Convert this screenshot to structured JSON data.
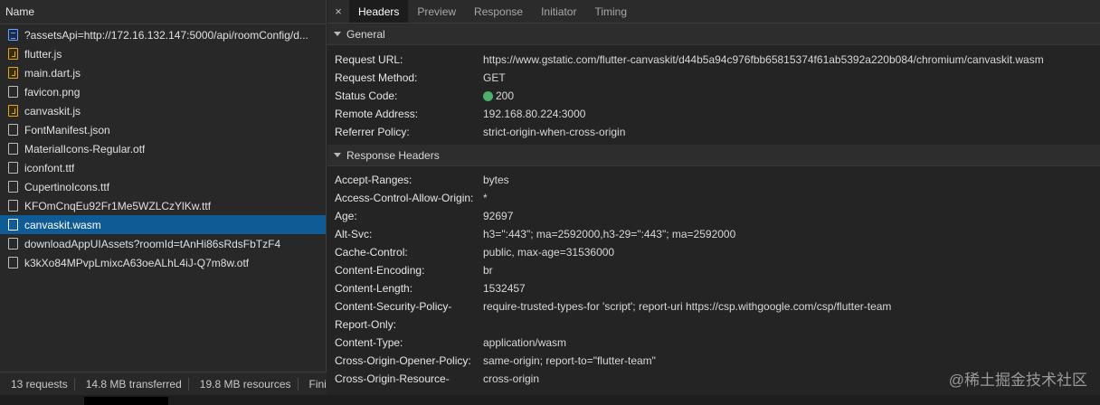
{
  "left_panel": {
    "header": "Name",
    "files": [
      {
        "name": "?assetsApi=http://172.16.132.147:5000/api/roomConfig/d...",
        "icon": "document-icon",
        "type": "doc"
      },
      {
        "name": "flutter.js",
        "icon": "script-file-icon",
        "type": "js"
      },
      {
        "name": "main.dart.js",
        "icon": "script-file-icon",
        "type": "js"
      },
      {
        "name": "favicon.png",
        "icon": "file-icon",
        "type": "plain"
      },
      {
        "name": "canvaskit.js",
        "icon": "script-file-icon",
        "type": "js"
      },
      {
        "name": "FontManifest.json",
        "icon": "file-icon",
        "type": "plain"
      },
      {
        "name": "MaterialIcons-Regular.otf",
        "icon": "file-icon",
        "type": "plain"
      },
      {
        "name": "iconfont.ttf",
        "icon": "file-icon",
        "type": "plain"
      },
      {
        "name": "CupertinoIcons.ttf",
        "icon": "file-icon",
        "type": "plain"
      },
      {
        "name": "KFOmCnqEu92Fr1Me5WZLCzYlKw.ttf",
        "icon": "file-icon",
        "type": "plain"
      },
      {
        "name": "canvaskit.wasm",
        "icon": "file-icon",
        "type": "plain",
        "selected": true
      },
      {
        "name": "downloadAppUIAssets?roomId=tAnHi86sRdsFbTzF4",
        "icon": "file-icon",
        "type": "plain"
      },
      {
        "name": "k3kXo84MPvpLmixcA63oeALhL4iJ-Q7m8w.otf",
        "icon": "file-icon",
        "type": "plain"
      }
    ],
    "status": {
      "requests": "13 requests",
      "transferred": "14.8 MB transferred",
      "resources": "19.8 MB resources",
      "finish": "Fini"
    }
  },
  "tabs": {
    "close": "×",
    "items": [
      "Headers",
      "Preview",
      "Response",
      "Initiator",
      "Timing"
    ],
    "active": "Headers"
  },
  "general": {
    "title": "General",
    "rows": [
      {
        "key": "Request URL:",
        "value": "https://www.gstatic.com/flutter-canvaskit/d44b5a94c976fbb65815374f61ab5392a220b084/chromium/canvaskit.wasm"
      },
      {
        "key": "Request Method:",
        "value": "GET"
      },
      {
        "key": "Status Code:",
        "value": "200",
        "status_color": "#4caf6a"
      },
      {
        "key": "Remote Address:",
        "value": "192.168.80.224:3000"
      },
      {
        "key": "Referrer Policy:",
        "value": "strict-origin-when-cross-origin"
      }
    ]
  },
  "response_headers": {
    "title": "Response Headers",
    "rows": [
      {
        "key": "Accept-Ranges:",
        "value": "bytes"
      },
      {
        "key": "Access-Control-Allow-Origin:",
        "value": "*"
      },
      {
        "key": "Age:",
        "value": "92697"
      },
      {
        "key": "Alt-Svc:",
        "value": "h3=\":443\"; ma=2592000,h3-29=\":443\"; ma=2592000"
      },
      {
        "key": "Cache-Control:",
        "value": "public, max-age=31536000"
      },
      {
        "key": "Content-Encoding:",
        "value": "br"
      },
      {
        "key": "Content-Length:",
        "value": "1532457"
      },
      {
        "key": "Content-Security-Policy-",
        "value": "require-trusted-types-for 'script'; report-uri https://csp.withgoogle.com/csp/flutter-team"
      },
      {
        "key": "Report-Only:",
        "value": ""
      },
      {
        "key": "Content-Type:",
        "value": "application/wasm"
      },
      {
        "key": "Cross-Origin-Opener-Policy:",
        "value": "same-origin; report-to=\"flutter-team\""
      },
      {
        "key": "Cross-Origin-Resource-",
        "value": "cross-origin"
      }
    ]
  },
  "watermark": "@稀土掘金技术社区",
  "colors": {
    "selected_row": "#0f5b95",
    "status_ok": "#4caf6a",
    "background": "#242424"
  }
}
